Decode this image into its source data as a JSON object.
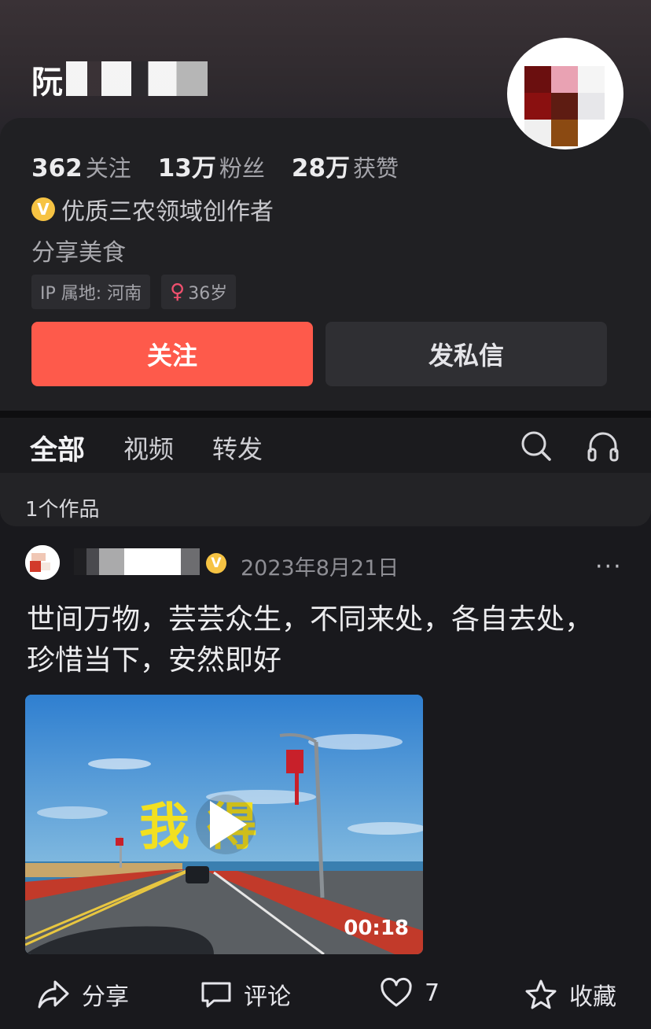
{
  "profile": {
    "name_visible": "阮",
    "stats": [
      {
        "num": "362",
        "label": "关注"
      },
      {
        "num": "13万",
        "label": "粉丝"
      },
      {
        "num": "28万",
        "label": "获赞"
      }
    ],
    "verified_badge": "V",
    "verified_title": "优质三农领域创作者",
    "bio": "分享美食",
    "ip_tag": "IP 属地: 河南",
    "gender_icon": "female-icon",
    "age_tag": "36岁"
  },
  "actions": {
    "follow": "关注",
    "message": "发私信"
  },
  "tabs": [
    {
      "label": "全部",
      "active": true
    },
    {
      "label": "视频",
      "active": false
    },
    {
      "label": "转发",
      "active": false
    }
  ],
  "tab_icons": [
    "search-icon",
    "headphones-icon"
  ],
  "works_count": "1个作品",
  "post": {
    "verified_badge": "V",
    "date": "2023年8月21日",
    "more": "···",
    "text": "世间万物，芸芸众生，不同来处，各自去处，珍惜当下，安然即好",
    "video": {
      "overlay_text": "我 得",
      "duration": "00:18"
    },
    "actions": [
      {
        "icon": "share-icon",
        "label": "分享"
      },
      {
        "icon": "comment-icon",
        "label": "评论"
      },
      {
        "icon": "heart-icon",
        "label": "7"
      },
      {
        "icon": "star-icon",
        "label": "收藏"
      }
    ]
  },
  "colors": {
    "accent": "#fe5a4b",
    "background": "#19191d",
    "card": "#202023",
    "verified": "#f6c343"
  }
}
